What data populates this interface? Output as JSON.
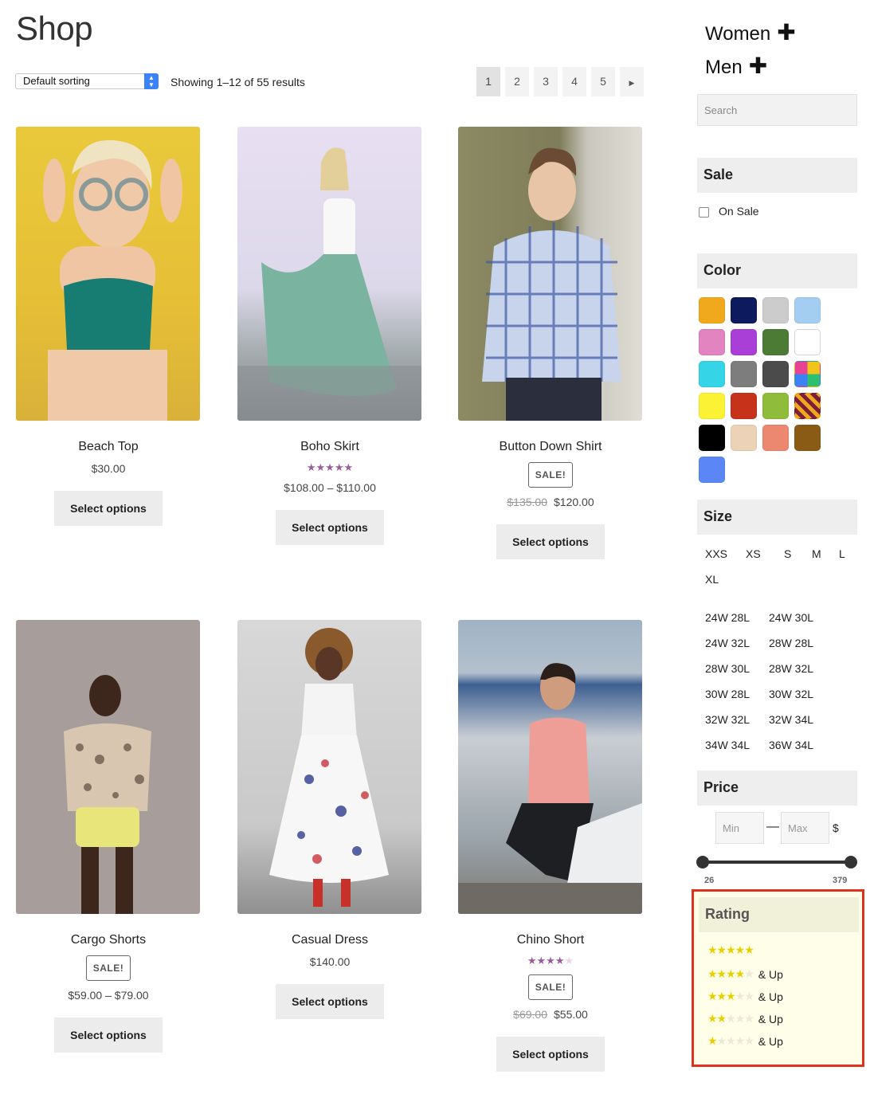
{
  "page": {
    "title": "Shop"
  },
  "toolbar": {
    "sort_value": "Default sorting",
    "result_count": "Showing 1–12 of 55 results",
    "pages": [
      "1",
      "2",
      "3",
      "4",
      "5"
    ],
    "next_icon": "caret-right-icon"
  },
  "products": [
    {
      "name": "Beach Top",
      "price": "$30.00",
      "button": "Select options"
    },
    {
      "name": "Boho Skirt",
      "rating_stars": 5,
      "price": "$108.00 – $110.00",
      "button": "Select options"
    },
    {
      "name": "Button Down Shirt",
      "badge": "SALE!",
      "old_price": "$135.00",
      "price": "$120.00",
      "button": "Select options"
    },
    {
      "name": "Cargo Shorts",
      "badge": "SALE!",
      "price": "$59.00 – $79.00",
      "button": "Select options"
    },
    {
      "name": "Casual Dress",
      "price": "$140.00",
      "button": "Select options"
    },
    {
      "name": "Chino Short",
      "rating_stars": 4,
      "badge": "SALE!",
      "old_price": "$69.00",
      "price": "$55.00",
      "button": "Select options"
    }
  ],
  "sidebar": {
    "categories": [
      {
        "label": "Women",
        "icon": "plus-icon"
      },
      {
        "label": "Men",
        "icon": "plus-icon"
      }
    ],
    "search_placeholder": "Search",
    "sale": {
      "title": "Sale",
      "option": "On Sale"
    },
    "color": {
      "title": "Color",
      "swatches": [
        "#f0a81c",
        "#0d1b5e",
        "#cccccc",
        "#a4cdf2",
        "#e184c0",
        "#a93fd6",
        "#4b7b35",
        "#ffffff",
        "#35d4e6",
        "#7d7d7d",
        "#4b4b4b",
        "multicolor",
        "#fcf235",
        "#c7321a",
        "#8fbc3a",
        "pattern",
        "#000000",
        "#ecd2b7",
        "#ec8870",
        "#8a5b14",
        "#5b86f5"
      ]
    },
    "size": {
      "title": "Size",
      "letters": [
        "XXS",
        "XS",
        "S",
        "M",
        "L",
        "XL"
      ],
      "waist": [
        [
          "24W 28L",
          "24W 30L"
        ],
        [
          "24W 32L",
          "28W 28L"
        ],
        [
          "28W 30L",
          "28W 32L"
        ],
        [
          "30W 28L",
          "30W 32L"
        ],
        [
          "32W 32L",
          "32W 34L"
        ],
        [
          "34W 34L",
          "36W 34L"
        ]
      ]
    },
    "price": {
      "title": "Price",
      "min_placeholder": "Min",
      "max_placeholder": "Max",
      "separator": "—",
      "currency": "$",
      "range_min": "26",
      "range_max": "379"
    },
    "rating": {
      "title": "Rating",
      "options": [
        {
          "stars": 5,
          "label": ""
        },
        {
          "stars": 4,
          "label": "& Up"
        },
        {
          "stars": 3,
          "label": "& Up"
        },
        {
          "stars": 2,
          "label": "& Up"
        },
        {
          "stars": 1,
          "label": "& Up"
        }
      ]
    }
  }
}
